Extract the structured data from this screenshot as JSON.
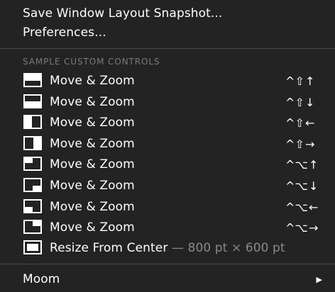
{
  "menu": {
    "top_items": [
      {
        "label": "Save Window Layout Snapshot..."
      },
      {
        "label": "Preferences..."
      }
    ],
    "section_header": "SAMPLE CUSTOM CONTROLS",
    "controls": [
      {
        "label": "Move & Zoom",
        "icon": "zoom-top-half-icon",
        "mod": "^⇧",
        "key": "↑"
      },
      {
        "label": "Move & Zoom",
        "icon": "zoom-bottom-half-icon",
        "mod": "^⇧",
        "key": "↓"
      },
      {
        "label": "Move & Zoom",
        "icon": "zoom-left-half-icon",
        "mod": "^⇧",
        "key": "←"
      },
      {
        "label": "Move & Zoom",
        "icon": "zoom-right-half-icon",
        "mod": "^⇧",
        "key": "→"
      },
      {
        "label": "Move & Zoom",
        "icon": "zoom-top-left-quarter-icon",
        "mod": "^⌥",
        "key": "↑"
      },
      {
        "label": "Move & Zoom",
        "icon": "zoom-bottom-right-quarter-icon",
        "mod": "^⌥",
        "key": "↓"
      },
      {
        "label": "Move & Zoom",
        "icon": "zoom-bottom-left-quarter-icon",
        "mod": "^⌥",
        "key": "←"
      },
      {
        "label": "Move & Zoom",
        "icon": "zoom-top-right-quarter-icon",
        "mod": "^⌥",
        "key": "→"
      }
    ],
    "resize": {
      "label": "Resize From Center",
      "detail": "— 800 pt × 600 pt",
      "icon": "resize-center-icon"
    },
    "moom": {
      "label": "Moom",
      "arrow": "▶"
    }
  }
}
